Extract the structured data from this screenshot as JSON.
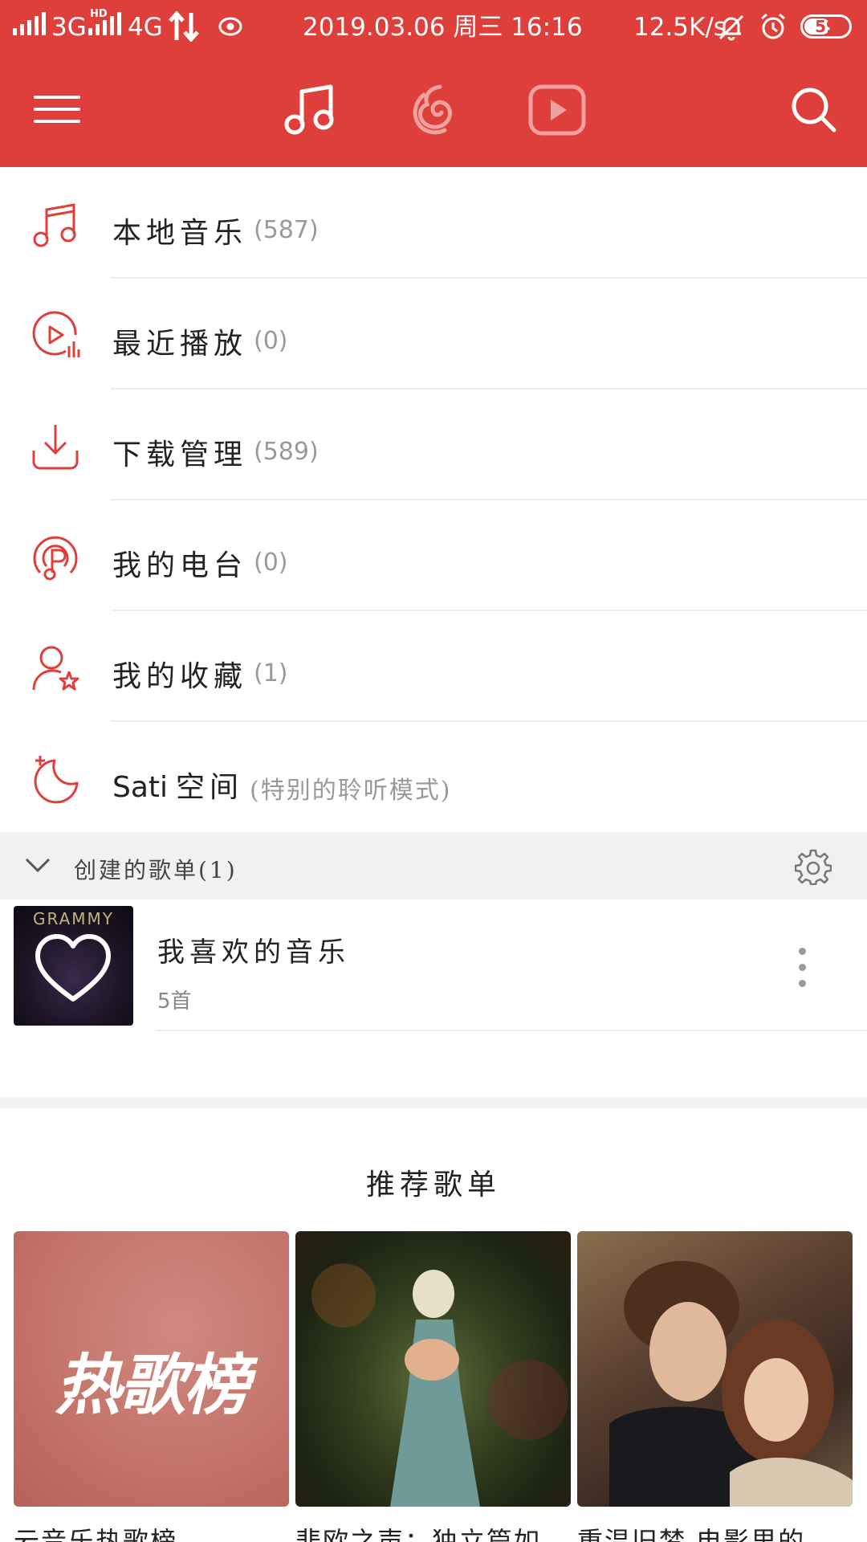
{
  "status_bar": {
    "net1": "3G",
    "hd": "HD",
    "net2": "4G",
    "datetime": "2019.03.06 周三 16:16",
    "speed": "12.5K/s",
    "battery": "59"
  },
  "header": {
    "tabs": [
      "music-tab",
      "discover-tab",
      "video-tab"
    ],
    "active_tab": "music-tab",
    "accent_color": "#df3f3a"
  },
  "menu": [
    {
      "label": "本地音乐",
      "count": "(587)"
    },
    {
      "label": "最近播放",
      "count": "(0)"
    },
    {
      "label": "下载管理",
      "count": "(589)"
    },
    {
      "label": "我的电台",
      "count": "(0)"
    },
    {
      "label": "我的收藏",
      "count": "(1)"
    },
    {
      "label_latin": "Sati",
      "label": "空间",
      "count": "(特别的聆听模式)"
    }
  ],
  "created_playlists": {
    "header": "创建的歌单(1)",
    "items": [
      {
        "title": "我喜欢的音乐",
        "subtitle": "5首",
        "cover_text": "GRAMMY"
      }
    ]
  },
  "recommended": {
    "title": "推荐歌单",
    "cards": [
      {
        "cover_text": "热歌榜",
        "caption": "云音乐热歌榜"
      },
      {
        "caption": "悲欧之声：独立篇如..."
      },
      {
        "caption": "重温旧梦 电影里的..."
      }
    ]
  }
}
